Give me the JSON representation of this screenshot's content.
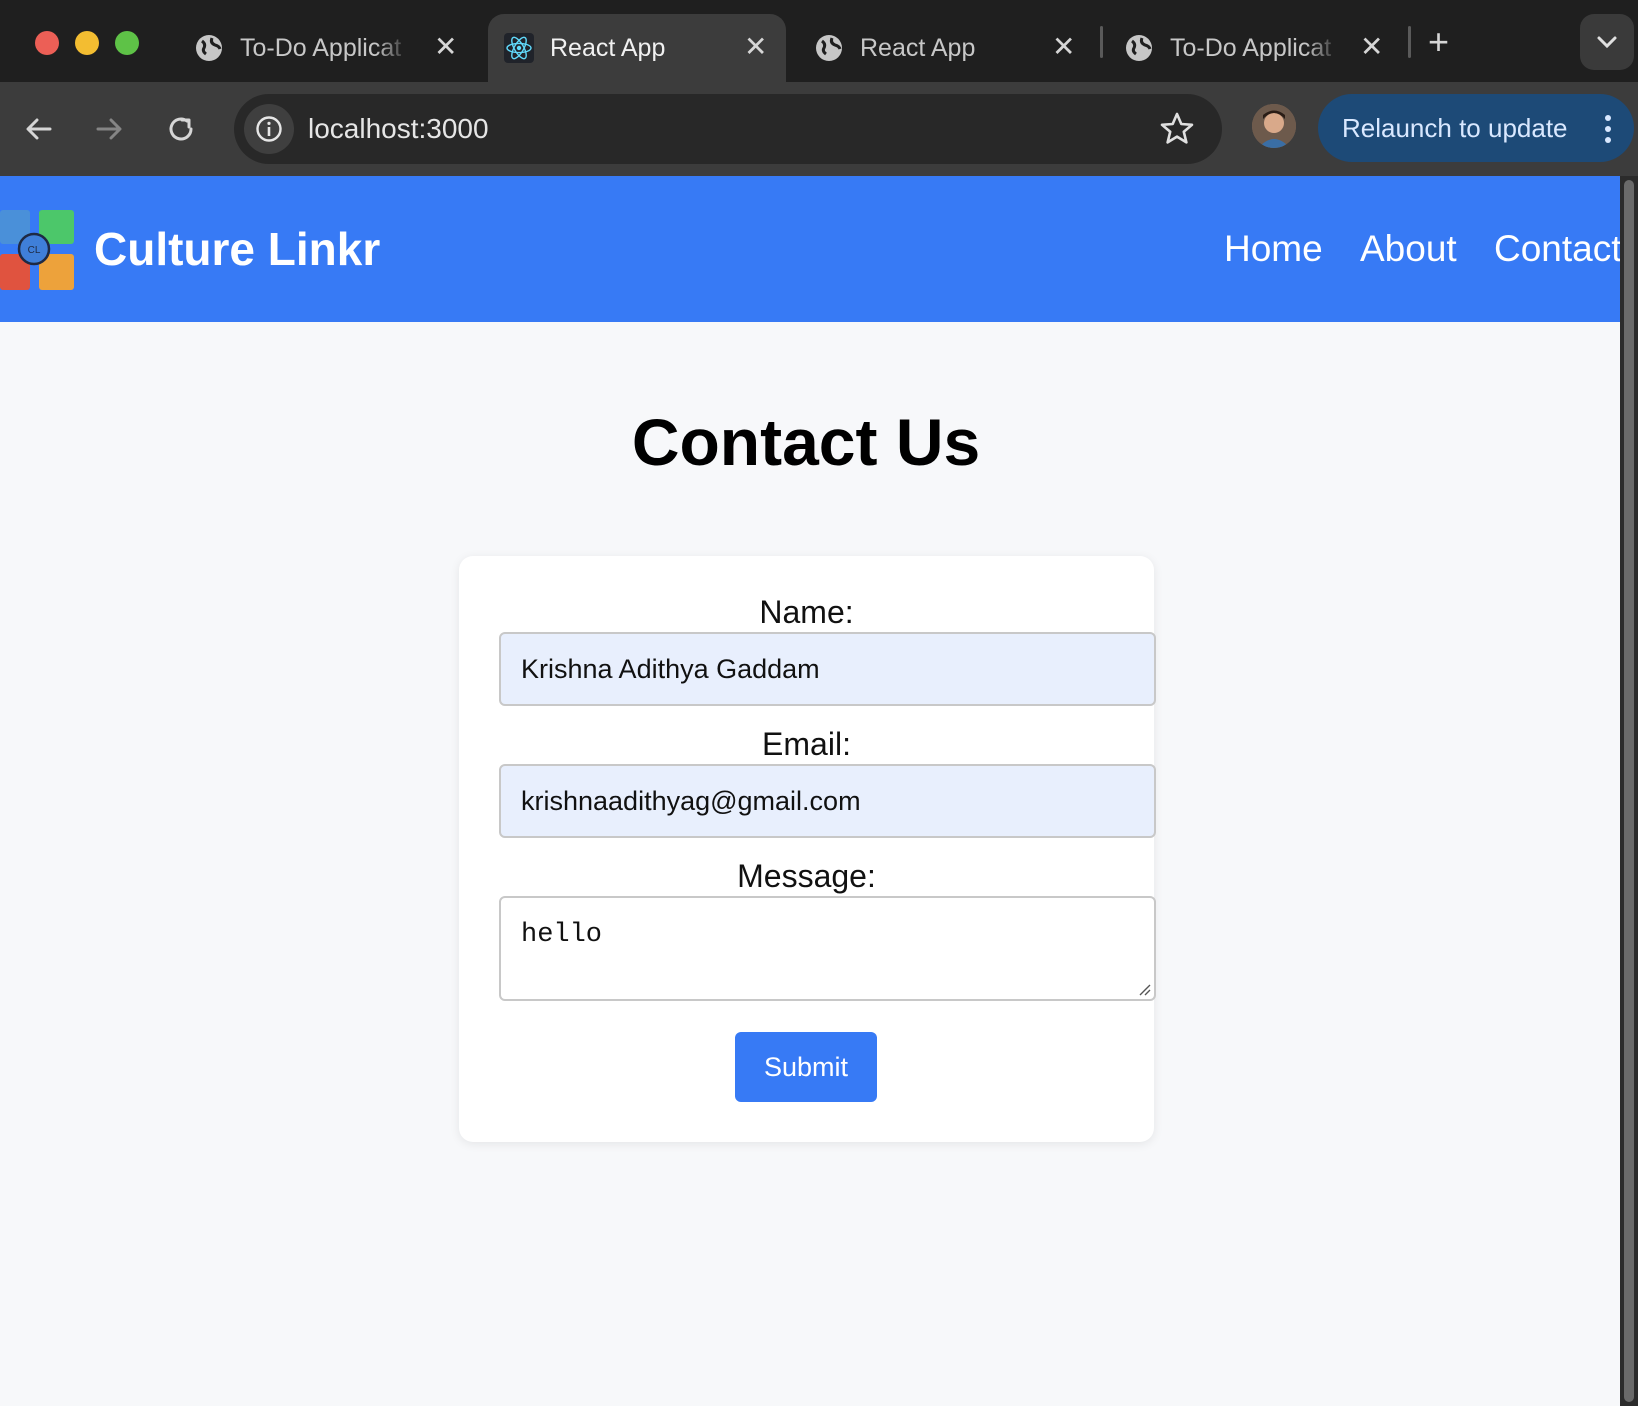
{
  "browser": {
    "tabs": [
      {
        "title": "To-Do Applicat",
        "active": false,
        "icon": "globe-icon"
      },
      {
        "title": "React App",
        "active": true,
        "icon": "react-icon"
      },
      {
        "title": "React App",
        "active": false,
        "icon": "globe-icon"
      },
      {
        "title": "To-Do Applicat",
        "active": false,
        "icon": "globe-icon"
      }
    ],
    "new_tab": "+",
    "url": "localhost:3000",
    "relaunch_label": "Relaunch to update"
  },
  "navbar": {
    "logo_text": "CL",
    "brand": "Culture Linkr",
    "links": [
      "Home",
      "About",
      "Contact"
    ],
    "bg_color": "#377af5"
  },
  "contact": {
    "heading": "Contact Us",
    "name_label": "Name:",
    "name_value": "Krishna Adithya Gaddam",
    "email_label": "Email:",
    "email_value": "krishnaadithyag@gmail.com",
    "message_label": "Message:",
    "message_value": "hello",
    "submit_label": "Submit"
  }
}
